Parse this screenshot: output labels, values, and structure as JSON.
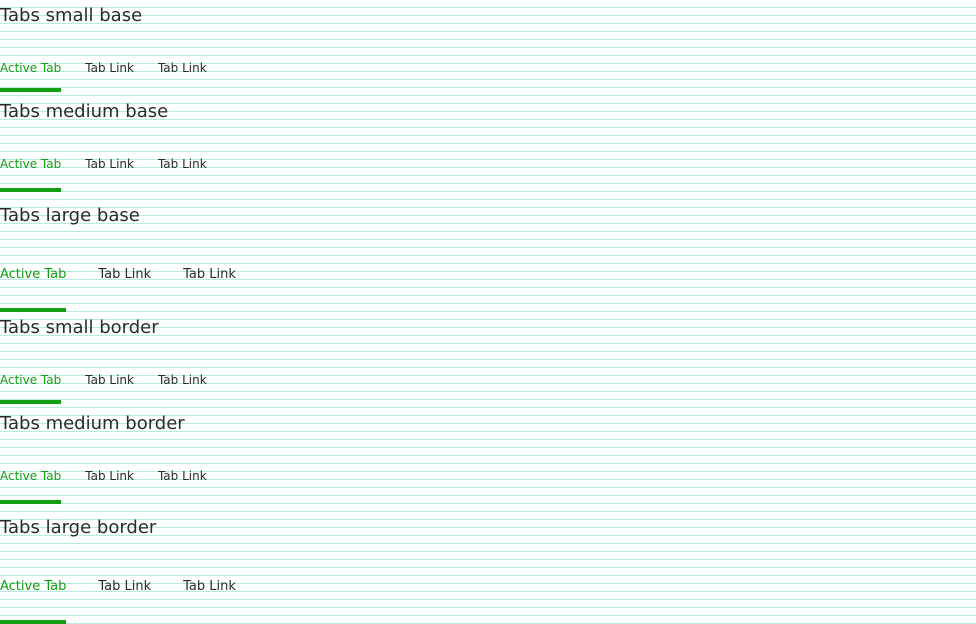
{
  "colors": {
    "accent": "#12a012",
    "text": "#2b2b2b",
    "grid_line": "#b2ece4",
    "background": "#ffffff"
  },
  "sections": [
    {
      "title": "Tabs small base",
      "tabs": [
        {
          "label": "Active Tab",
          "active": true
        },
        {
          "label": "Tab Link",
          "active": false
        },
        {
          "label": "Tab Link",
          "active": false
        }
      ]
    },
    {
      "title": "Tabs medium base",
      "tabs": [
        {
          "label": "Active Tab",
          "active": true
        },
        {
          "label": "Tab Link",
          "active": false
        },
        {
          "label": "Tab Link",
          "active": false
        }
      ]
    },
    {
      "title": "Tabs large base",
      "tabs": [
        {
          "label": "Active Tab",
          "active": true
        },
        {
          "label": "Tab Link",
          "active": false
        },
        {
          "label": "Tab Link",
          "active": false
        }
      ]
    },
    {
      "title": "Tabs small border",
      "tabs": [
        {
          "label": "Active Tab",
          "active": true
        },
        {
          "label": "Tab Link",
          "active": false
        },
        {
          "label": "Tab Link",
          "active": false
        }
      ]
    },
    {
      "title": "Tabs medium border",
      "tabs": [
        {
          "label": "Active Tab",
          "active": true
        },
        {
          "label": "Tab Link",
          "active": false
        },
        {
          "label": "Tab Link",
          "active": false
        }
      ]
    },
    {
      "title": "Tabs large border",
      "tabs": [
        {
          "label": "Active Tab",
          "active": true
        },
        {
          "label": "Tab Link",
          "active": false
        },
        {
          "label": "Tab Link",
          "active": false
        }
      ]
    }
  ]
}
